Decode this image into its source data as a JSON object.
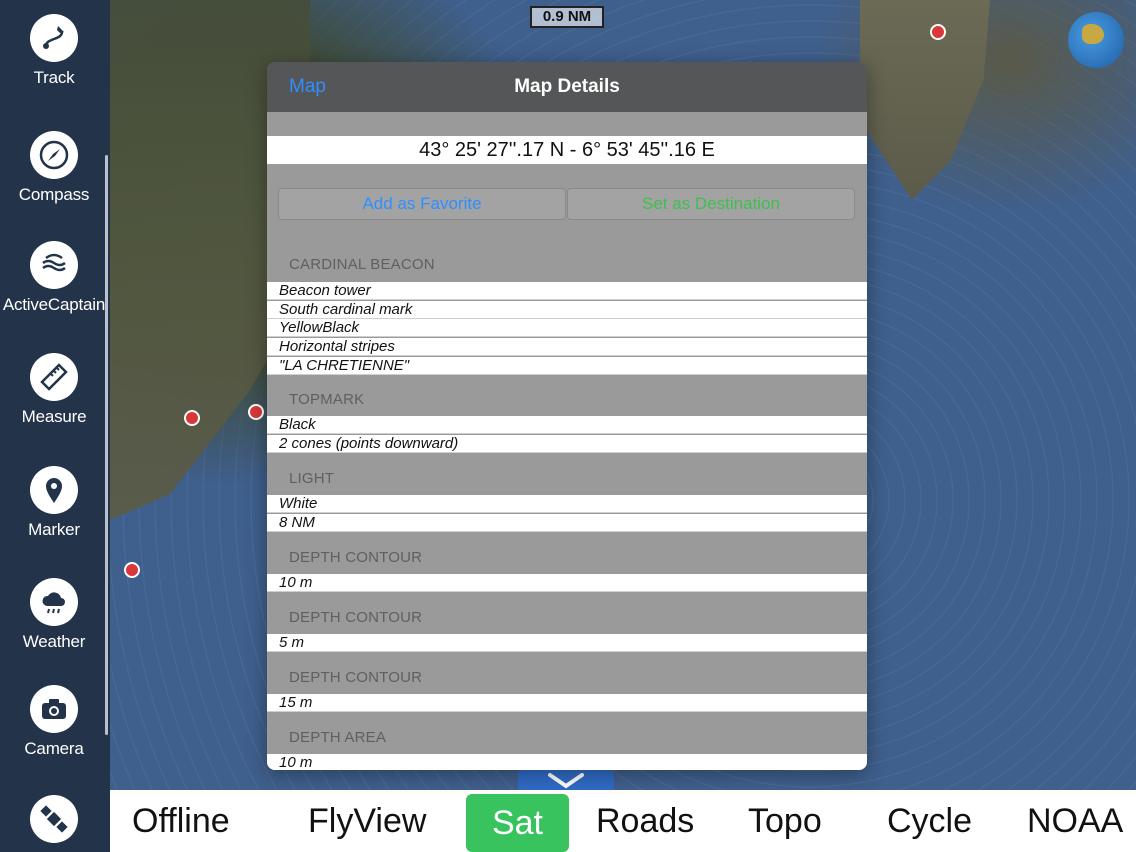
{
  "map": {
    "scale_label": "0.9 NM"
  },
  "sidebar": {
    "items": [
      {
        "label": "Track",
        "icon": "track-icon"
      },
      {
        "label": "Compass",
        "icon": "compass-icon"
      },
      {
        "label": "ActiveCaptain",
        "icon": "activecaptain-icon"
      },
      {
        "label": "Measure",
        "icon": "ruler-icon"
      },
      {
        "label": "Marker",
        "icon": "map-pin-icon"
      },
      {
        "label": "Weather",
        "icon": "cloud-rain-icon"
      },
      {
        "label": "Camera",
        "icon": "camera-icon"
      },
      {
        "label": "",
        "icon": "satellite-icon"
      }
    ]
  },
  "map_types": {
    "items": [
      "Offline",
      "FlyView",
      "Sat",
      "Roads",
      "Topo",
      "Cycle",
      "NOAA"
    ],
    "selected": "Sat",
    "active_color": "#39c35e"
  },
  "modal": {
    "back_label": "Map",
    "title": "Map Details",
    "coordinates": "43° 25' 27''.17 N  -  6° 53' 45''.16 E",
    "add_favorite_label": "Add as Favorite",
    "set_destination_label": "Set as Destination",
    "sections": [
      {
        "header": "CARDINAL BEACON",
        "rows": [
          "Beacon tower",
          "South cardinal mark",
          "YellowBlack",
          "Horizontal stripes",
          "\"LA CHRETIENNE\""
        ]
      },
      {
        "header": "TOPMARK",
        "rows": [
          "Black",
          "2 cones (points downward)"
        ]
      },
      {
        "header": "LIGHT",
        "rows": [
          "White",
          "8 NM"
        ]
      },
      {
        "header": "DEPTH CONTOUR",
        "rows": [
          "10 m"
        ]
      },
      {
        "header": "DEPTH CONTOUR",
        "rows": [
          "5 m"
        ]
      },
      {
        "header": "DEPTH CONTOUR",
        "rows": [
          "15 m"
        ]
      },
      {
        "header": "DEPTH AREA",
        "rows": [
          "10 m"
        ]
      }
    ]
  }
}
